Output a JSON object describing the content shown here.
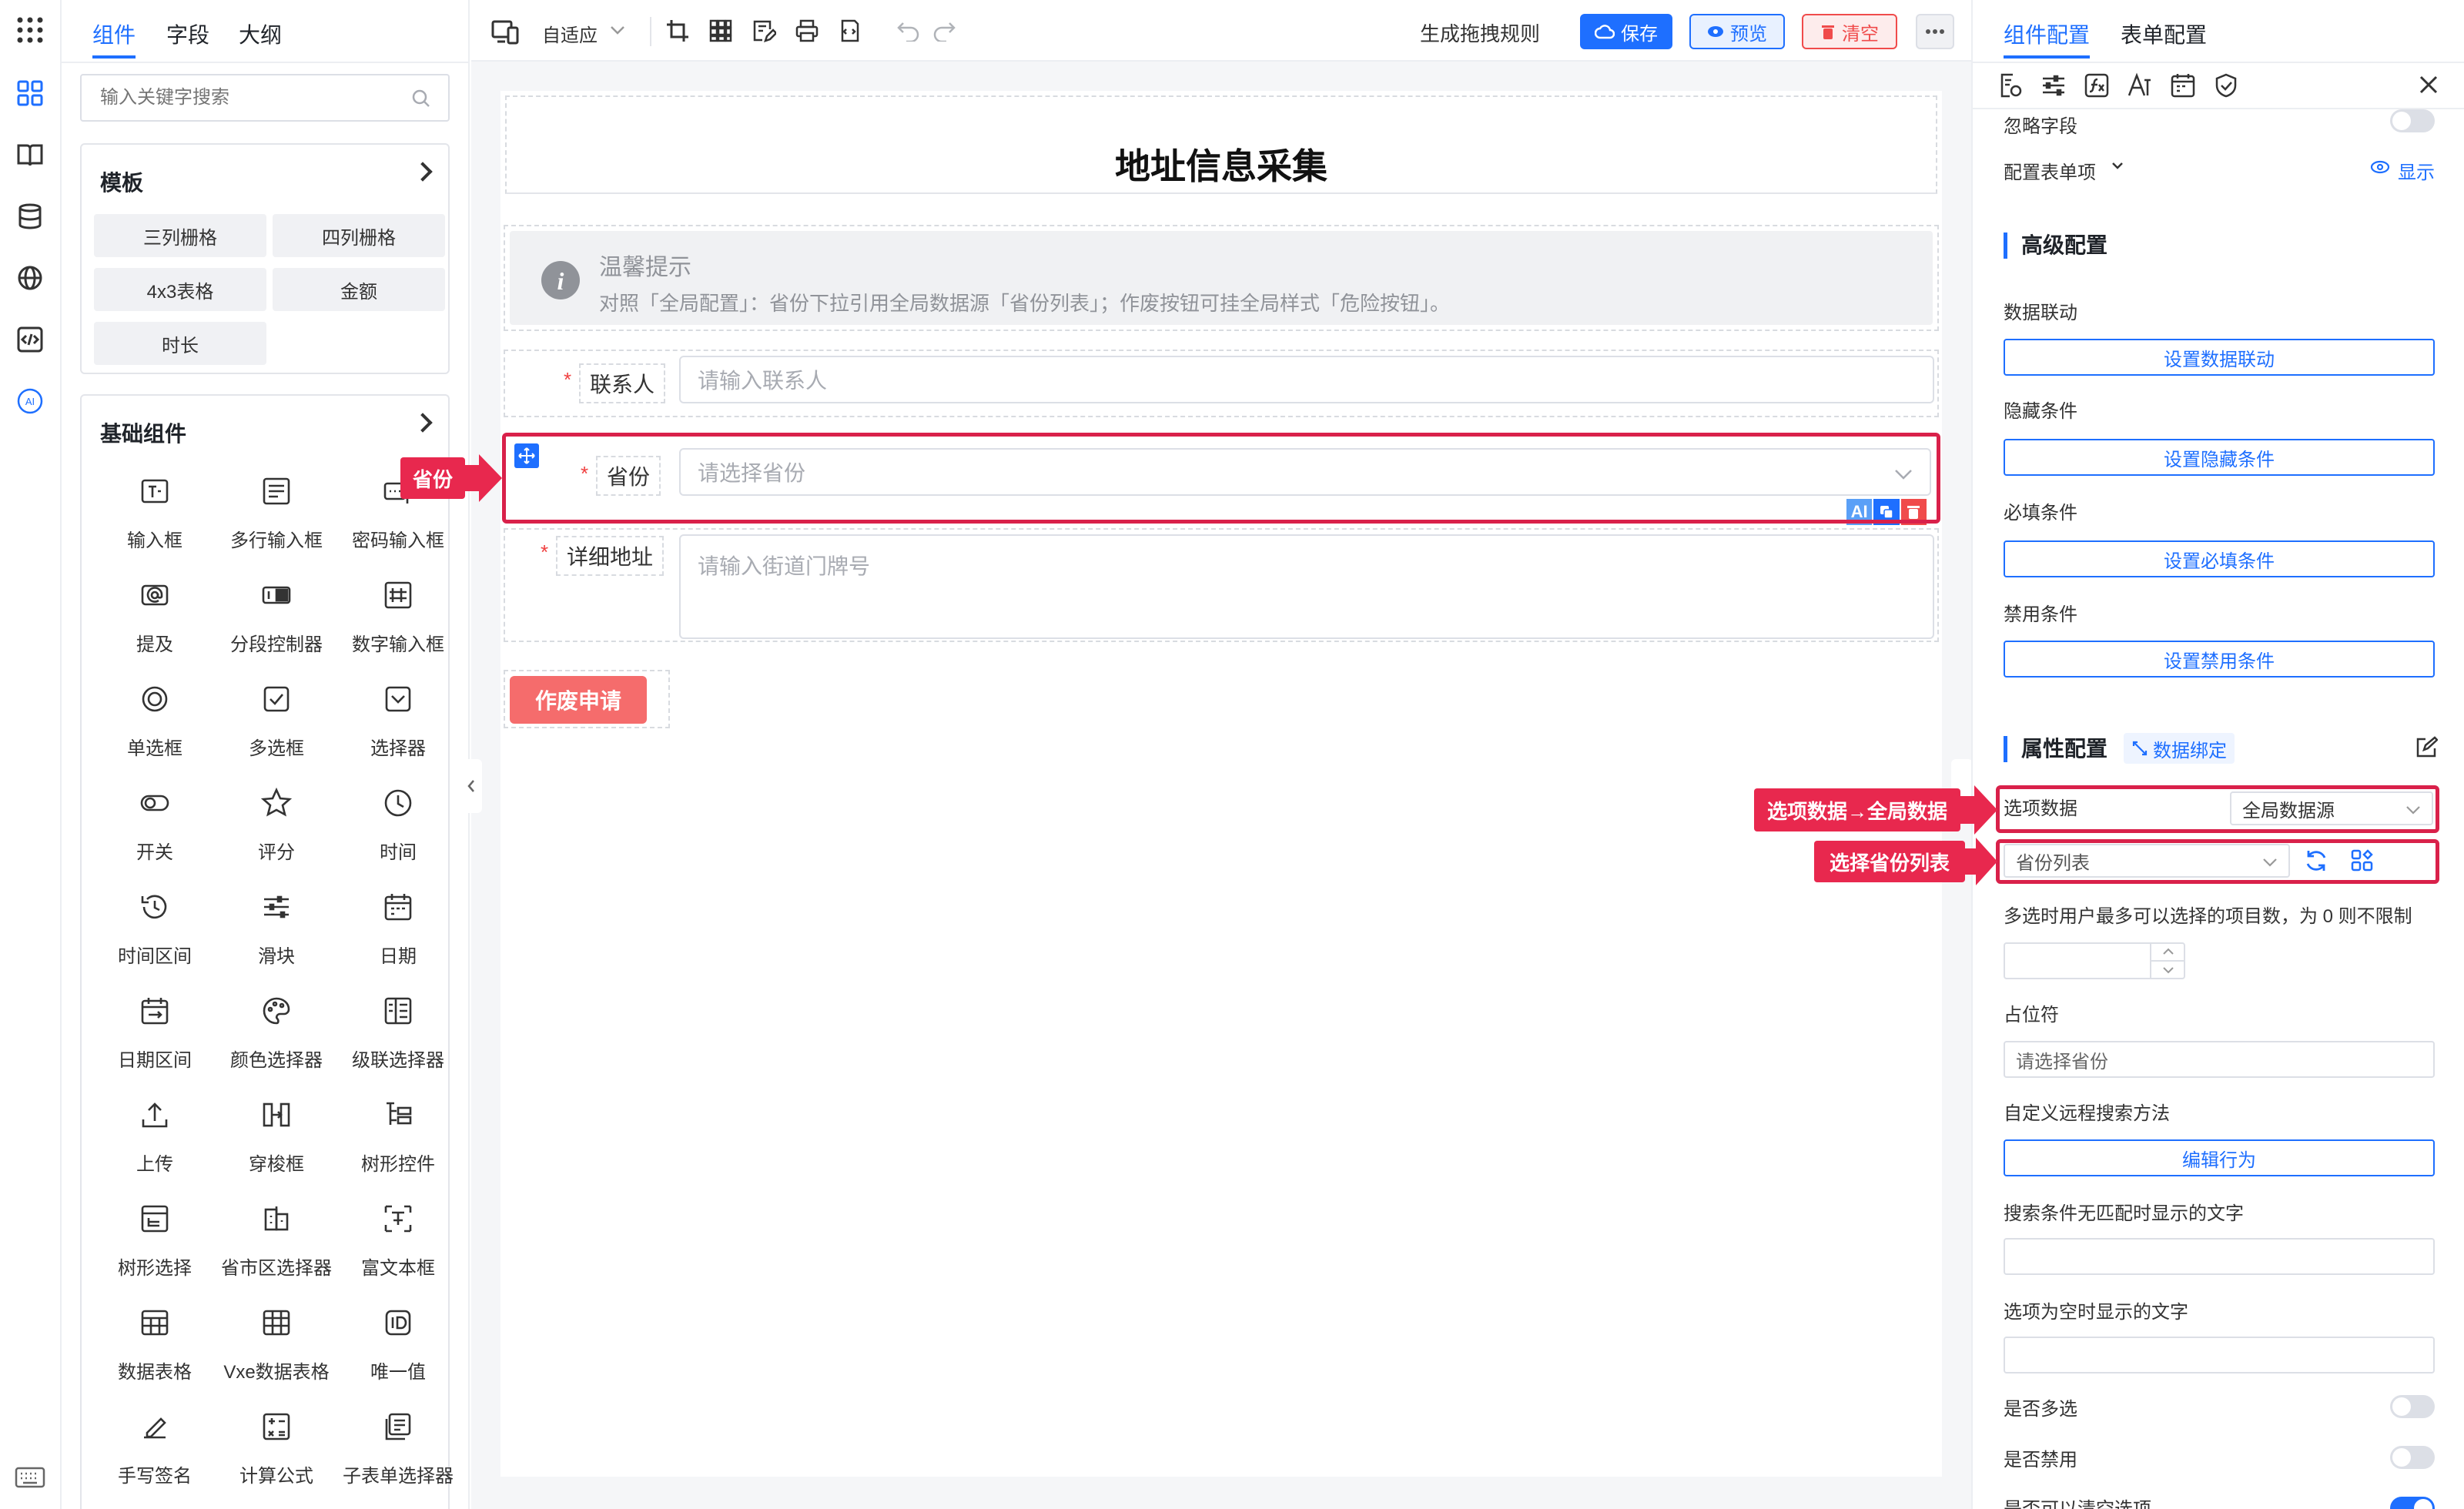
{
  "left": {
    "tabs": [
      "组件",
      "字段",
      "大纲"
    ],
    "search_placeholder": "输入关键字搜索",
    "templates": {
      "title": "模板",
      "items": [
        "三列栅格",
        "四列栅格",
        "4x3表格",
        "金额",
        "时长"
      ]
    },
    "basic": {
      "title": "基础组件",
      "items": [
        "输入框",
        "多行输入框",
        "密码输入框",
        "提及",
        "分段控制器",
        "数字输入框",
        "单选框",
        "多选框",
        "选择器",
        "开关",
        "评分",
        "时间",
        "时间区间",
        "滑块",
        "日期",
        "日期区间",
        "颜色选择器",
        "级联选择器",
        "上传",
        "穿梭框",
        "树形控件",
        "树形选择",
        "省市区选择器",
        "富文本框",
        "数据表格",
        "Vxe数据表格",
        "唯一值",
        "手写签名",
        "计算公式",
        "子表单选择器"
      ]
    }
  },
  "toolbar": {
    "device": "自适应",
    "gen_rules": "生成拖拽规则",
    "save": "保存",
    "preview": "预览",
    "clear": "清空"
  },
  "form": {
    "title": "地址信息采集",
    "alert_title": "温馨提示",
    "alert_desc": "对照「全局配置」：省份下拉引用全局数据源「省份列表」；作废按钮可挂全局样式「危险按钮」。",
    "contact_label": "联系人",
    "contact_placeholder": "请输入联系人",
    "province_label": "省份",
    "province_placeholder": "请选择省份",
    "address_label": "详细地址",
    "address_placeholder": "请输入街道门牌号",
    "void_button": "作废申请",
    "ai_badge": "AI"
  },
  "annotations": {
    "province": "省份",
    "option_data": "选项数据→全局数据",
    "province_list": "选择省份列表"
  },
  "right": {
    "tabs": [
      "组件配置",
      "表单配置"
    ],
    "ignore_field": "忽略字段",
    "config_items": "配置表单项",
    "show": "显示",
    "advanced_title": "高级配置",
    "linkage_label": "数据联动",
    "linkage_btn": "设置数据联动",
    "hidden_label": "隐藏条件",
    "hidden_btn": "设置隐藏条件",
    "required_label": "必填条件",
    "required_btn": "设置必填条件",
    "disabled_label": "禁用条件",
    "disabled_btn": "设置禁用条件",
    "props_title": "属性配置",
    "data_binding": "数据绑定",
    "option_data_label": "选项数据",
    "option_data_value": "全局数据源",
    "province_list_value": "省份列表",
    "multiple_limit_label": "多选时用户最多可以选择的项目数，为 0 则不限制",
    "placeholder_label": "占位符",
    "placeholder_value": "请选择省份",
    "remote_method_label": "自定义远程搜索方法",
    "edit_behavior_btn": "编辑行为",
    "no_match_label": "搜索条件无匹配时显示的文字",
    "no_data_label": "选项为空时显示的文字",
    "multiple_label": "是否多选",
    "disabled_switch_label": "是否禁用",
    "clearable_label": "是否可以清空选项"
  },
  "colors": {
    "accent": "#1e6fff",
    "danger": "#f04b4b",
    "annotation": "#e8284e"
  }
}
